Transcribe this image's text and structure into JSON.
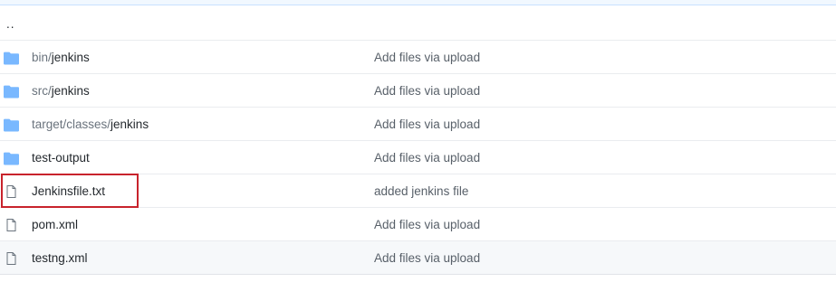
{
  "parent_link": {
    "label": ".."
  },
  "rows": [
    {
      "icon": "folder-icon",
      "name_prefix": "bin/",
      "name_main": "jenkins",
      "message": "Add files via upload"
    },
    {
      "icon": "folder-icon",
      "name_prefix": "src/",
      "name_main": "jenkins",
      "message": "Add files via upload"
    },
    {
      "icon": "folder-icon",
      "name_prefix": "target/classes/",
      "name_main": "jenkins",
      "message": "Add files via upload"
    },
    {
      "icon": "folder-icon",
      "name_prefix": "",
      "name_main": "test-output",
      "message": "Add files via upload"
    },
    {
      "icon": "file-icon",
      "name_prefix": "",
      "name_main": "Jenkinsfile.txt",
      "message": "added jenkins file"
    },
    {
      "icon": "file-icon",
      "name_prefix": "",
      "name_main": "pom.xml",
      "message": "Add files via upload"
    },
    {
      "icon": "file-icon",
      "name_prefix": "",
      "name_main": "testng.xml",
      "message": "Add files via upload"
    }
  ],
  "colors": {
    "folder": "#79b8ff",
    "file_outline": "#6a737d",
    "highlight": "#c8232c"
  }
}
